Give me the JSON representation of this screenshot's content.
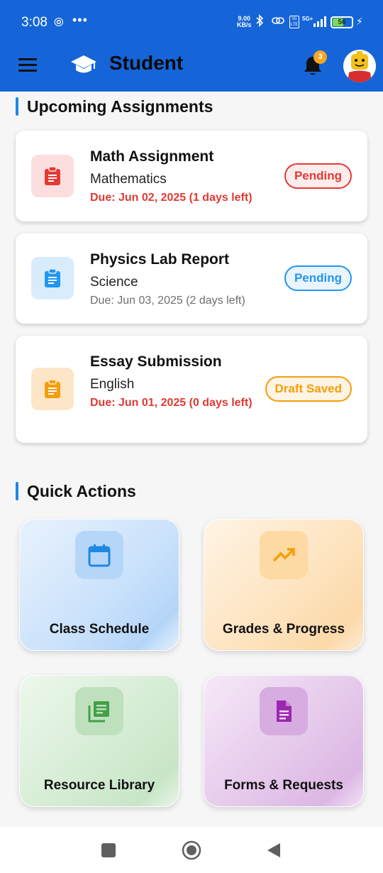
{
  "status_bar": {
    "time": "3:08",
    "net_speed_value": "9.00",
    "net_speed_unit": "KB/s",
    "network_type": "5G+",
    "volte": "Vo LTE",
    "battery_level": "56"
  },
  "app_bar": {
    "title": "Student",
    "notification_count": "3"
  },
  "upcoming": {
    "heading": "Upcoming Assignments",
    "items": [
      {
        "title": "Math Assignment",
        "subject": "Mathematics",
        "due": "Due: Jun 02, 2025 (1 days left)",
        "status": "Pending"
      },
      {
        "title": "Physics Lab Report",
        "subject": "Science",
        "due": "Due: Jun 03, 2025 (2 days left)",
        "status": "Pending"
      },
      {
        "title": "Essay Submission",
        "subject": "English",
        "due": "Due: Jun 01, 2025 (0 days left)",
        "status": "Draft Saved"
      }
    ]
  },
  "quick_actions": {
    "heading": "Quick Actions",
    "items": [
      {
        "label": "Class Schedule",
        "icon": "calendar-icon"
      },
      {
        "label": "Grades & Progress",
        "icon": "trending-up-icon"
      },
      {
        "label": "Resource Library",
        "icon": "library-icon"
      },
      {
        "label": "Forms & Requests",
        "icon": "document-icon"
      }
    ]
  },
  "colors": {
    "primary": "#1565d8",
    "accent_bar": "#1e88e5",
    "urgent_red": "#e03a33",
    "pending_blue": "#2196f3",
    "draft_orange": "#f59e0b"
  }
}
